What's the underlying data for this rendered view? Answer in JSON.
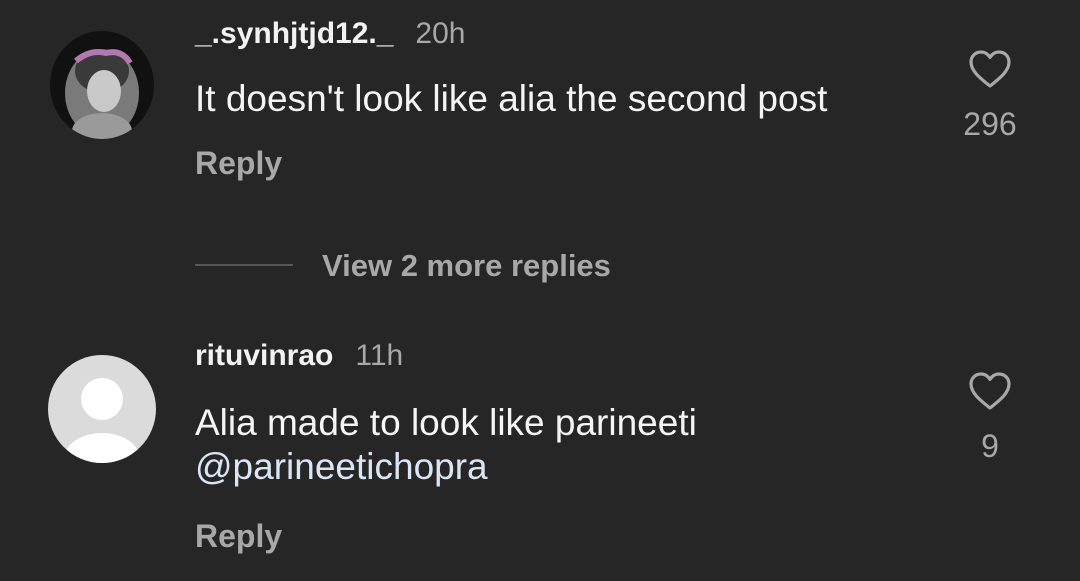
{
  "comments": [
    {
      "username": "_.synhjtjd12._",
      "time": "20h",
      "text": "It doesn't look like alia the second post",
      "reply_label": "Reply",
      "likes": "296",
      "avatar_icon": "profile-photo"
    },
    {
      "username": "rituvinrao",
      "time": "11h",
      "text_line1": "Alia made to look like parineeti",
      "mention": "@parineetichopra",
      "reply_label": "Reply",
      "likes": "9",
      "avatar_icon": "default-avatar-icon"
    }
  ],
  "view_replies_label": "View 2 more replies",
  "colors": {
    "background": "#262626",
    "primary_text": "#f5f5f5",
    "secondary_text": "#a8a8a8",
    "mention": "#dbe6f5"
  }
}
